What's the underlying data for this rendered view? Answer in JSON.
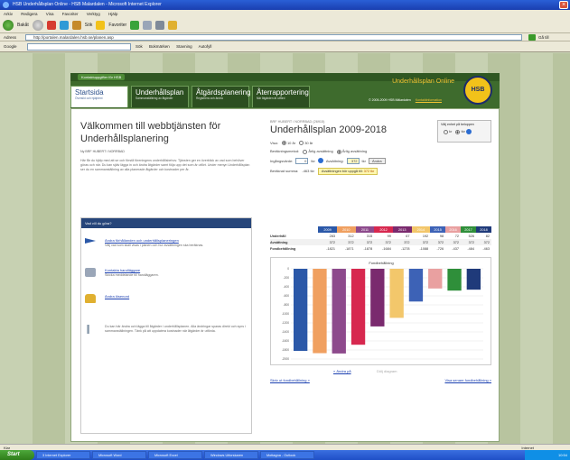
{
  "browser": {
    "title": "HSB Underhållsplan Online - HSB Malardalen - Microsoft Internet Explorer",
    "menu": [
      "Arkiv",
      "Redigera",
      "Visa",
      "Favoriter",
      "Verktyg",
      "Hjälp"
    ],
    "toolbar": {
      "back": "Bakåt",
      "search": "Sök",
      "favorites": "Favoriter"
    },
    "address_label": "Adress",
    "address": "http://portalen.malardalen.hsb.se/planen.asp",
    "go": "Gå till",
    "google_label": "Google",
    "google_items": [
      "Sök",
      "Bokmärken",
      "Stavning",
      "Autofyll"
    ],
    "status_left": "Klar",
    "status_right": "Internet"
  },
  "site": {
    "login_tab": "Kontaktuppgifter för HSB",
    "brand": "Underhållsplan Online",
    "seal": "HSB",
    "copyright": "© 2005-2009 HSB Mälardalen",
    "contact_link": "Kontaktinformation",
    "tabs": [
      {
        "title": "Startsida",
        "sub": "Översikt och hjälptext"
      },
      {
        "title": "Underhållsplan",
        "sub": "Sammanställning av åtgärder"
      },
      {
        "title": "Åtgärdsplanering",
        "sub": "Registrera och ändra"
      },
      {
        "title": "Återrapportering",
        "sub": "När åtgärden är utförd"
      }
    ]
  },
  "left": {
    "welcome": "Välkommen till webbtjänsten för Underhållsplanering",
    "sub": "Ny BRF HUBERT i NORRBAD",
    "para": "Här får du hjälp med att se och förstå föreningens underhållsbehov. Tjänsten ger en överblick av vad som behöver göras och när. Du kan själv lägga in och ändra åtgärder samt följa upp det som är utfört. Under menyn Underhållsplan ser du en sammanställning av alla planerade åtgärder och kostnader per år.",
    "want_head": "Vad vill du göra?",
    "items": [
      {
        "icon": "flag-icon",
        "link": "Ändra förhållanden och underhållsplaneringen",
        "desc": "Välj vad som skall visas i planen och hur avsättningen ska beräknas."
      },
      {
        "icon": "printer-icon",
        "link": "Kontakta handläggare",
        "desc": "Skicka meddelande till handläggaren."
      },
      {
        "icon": "lock-icon",
        "link": "Ändra lösenord",
        "desc": ""
      },
      {
        "icon": "tools-icon",
        "link": "",
        "desc": "Du kan här ändra och lägga till åtgärder i underhållsplanen. Alla ändringar sparas direkt och syns i sammanställningen. Tänk på att uppdatera kostnader när åtgärder är utförda."
      }
    ]
  },
  "right": {
    "breadcrumb": "BRF HUBERT / NORRBAD (26915)",
    "title": "Underhållsplan 2009-2018",
    "unit_box": {
      "label": "Välj enhet på beloppen",
      "opt1": "kr",
      "opt2": "tkr"
    },
    "view": {
      "label": "Visa:",
      "opt1": "10 år",
      "opt2": "30 år"
    },
    "calc": {
      "label": "Beräkningsmetod:",
      "opt1": "Årlig avsättning",
      "opt2": "Årlig avsättning"
    },
    "input_row": {
      "label": "Ingångsvärde:",
      "value": "0",
      "unit": "tkr",
      "label2": "Avsättning:",
      "value2": "372",
      "unit2": "tkr",
      "button": "Ändra"
    },
    "summary": {
      "label": "Beräknat summa:",
      "value": "-463 tkr",
      "hl_text": "Avsättningen bör uppgå till: ",
      "hl_value": "372 tkr"
    },
    "table": {
      "years": [
        "2009",
        "2010",
        "2011",
        "2012",
        "2013",
        "2014",
        "2015",
        "2016",
        "2017",
        "2018"
      ],
      "year_colors": [
        "#2b58a8",
        "#f0a060",
        "#8d4a8c",
        "#d7284f",
        "#7a2a6e",
        "#f3c76b",
        "#3d62b6",
        "#e9a0a0",
        "#2f8f3a",
        "#1f3a7a"
      ],
      "rows": [
        {
          "label": "Underhåll",
          "values": [
            "283",
            "312",
            "315",
            "99",
            "67",
            "192",
            "98",
            "72",
            "526",
            "82"
          ]
        },
        {
          "label": "Avsättning",
          "values": [
            "372",
            "372",
            "372",
            "372",
            "372",
            "372",
            "372",
            "372",
            "372",
            "372"
          ]
        },
        {
          "label": "Fondbehållning",
          "values": [
            "-1821",
            "-1871",
            "-1878",
            "-1684",
            "-1278",
            "-1088",
            "-726",
            "-437",
            "-484",
            "-463"
          ]
        }
      ]
    },
    "chart_link": "» Ändra på",
    "chart_link2": "Dölj diagram",
    "bottom_left": "Skriv ut fondbehållning »",
    "bottom_right": "Visa senare fondbehållning »"
  },
  "chart_data": {
    "type": "bar",
    "title": "Fondbehållning",
    "categories": [
      "2009",
      "2010",
      "2011",
      "2012",
      "2013",
      "2014",
      "2015",
      "2016",
      "2017",
      "2018"
    ],
    "values": [
      -1821,
      -1871,
      -1878,
      -1684,
      -1278,
      -1088,
      -726,
      -437,
      -484,
      -463
    ],
    "colors": [
      "#2b58a8",
      "#f0a060",
      "#8d4a8c",
      "#d7284f",
      "#7a2a6e",
      "#f3c76b",
      "#3d62b6",
      "#e9a0a0",
      "#2f8f3a",
      "#1f3a7a"
    ],
    "ylim": [
      -2000,
      0
    ],
    "yticks": [
      0,
      -200,
      -400,
      -600,
      -800,
      -1000,
      -1200,
      -1400,
      -1600,
      -1800,
      -2000
    ]
  },
  "taskbar": {
    "start": "Start",
    "tasks": [
      "3 Internet Explorer",
      "Microsoft Word",
      "Microsoft Excel",
      "Windows Utforskaren",
      "Mottagna - Outlook"
    ],
    "clock": "10:54"
  }
}
